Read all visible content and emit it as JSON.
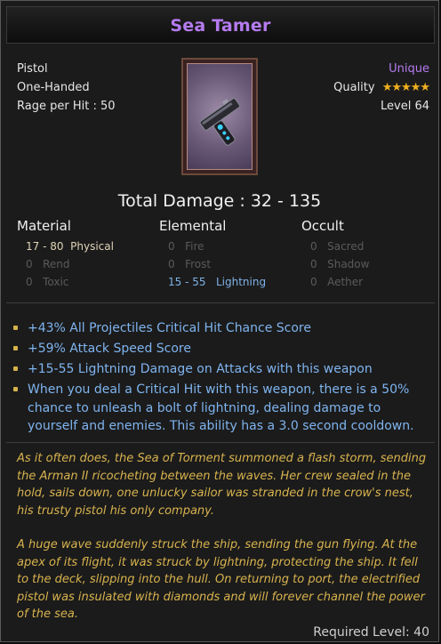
{
  "item": {
    "name": "Sea Tamer",
    "type": "Pistol",
    "handedness": "One-Handed",
    "rage_per_hit": "Rage per Hit : 50",
    "rarity": "Unique",
    "quality_label": "Quality",
    "quality_stars": 5,
    "level": "Level 64",
    "total_damage": "Total Damage : 32 - 135"
  },
  "damage_table": {
    "headers": [
      "Material",
      "Elemental",
      "Occult"
    ],
    "material": [
      {
        "value": "17 - 80",
        "label": "Physical"
      },
      {
        "value": "0",
        "label": "Rend"
      },
      {
        "value": "0",
        "label": "Toxic"
      }
    ],
    "elemental": [
      {
        "value": "0",
        "label": "Fire"
      },
      {
        "value": "0",
        "label": "Frost"
      },
      {
        "value": "15 - 55",
        "label": "Lightning"
      }
    ],
    "occult": [
      {
        "value": "0",
        "label": "Sacred"
      },
      {
        "value": "0",
        "label": "Shadow"
      },
      {
        "value": "0",
        "label": "Aether"
      }
    ]
  },
  "modifiers": [
    "+43% All Projectiles Critical Hit Chance Score",
    "+59% Attack Speed Score",
    "+15-55 Lightning Damage on Attacks with this weapon",
    "When you deal a Critical Hit with this weapon, there is a 50% chance to unleash a bolt of lightning, dealing damage to yourself and enemies. This ability has a 3.0 second cooldown."
  ],
  "lore": [
    "As it often does, the Sea of Torment summoned a flash storm, sending the Arman II ricocheting between the waves. Her crew sealed in the hold, sails down, one unlucky sailor was stranded in the crow's nest, his trusty pistol his only company.",
    "A huge wave suddenly struck the ship, sending the gun flying. At the apex of its flight, it was struck by lightning, protecting the ship. It fell to the deck, slipping into the hull. On returning to port, the electrified pistol was insulated with diamonds and will forever channel the power of the sea."
  ],
  "requirement": "Required Level: 40",
  "icons": {
    "item_art": "pistol-icon",
    "quality": "star-icon",
    "bullet": "bullet-icon"
  },
  "colors": {
    "unique": "#b57bf0",
    "magic": "#7fb4ef",
    "lore": "#d8b34e",
    "star": "#f0b020"
  }
}
